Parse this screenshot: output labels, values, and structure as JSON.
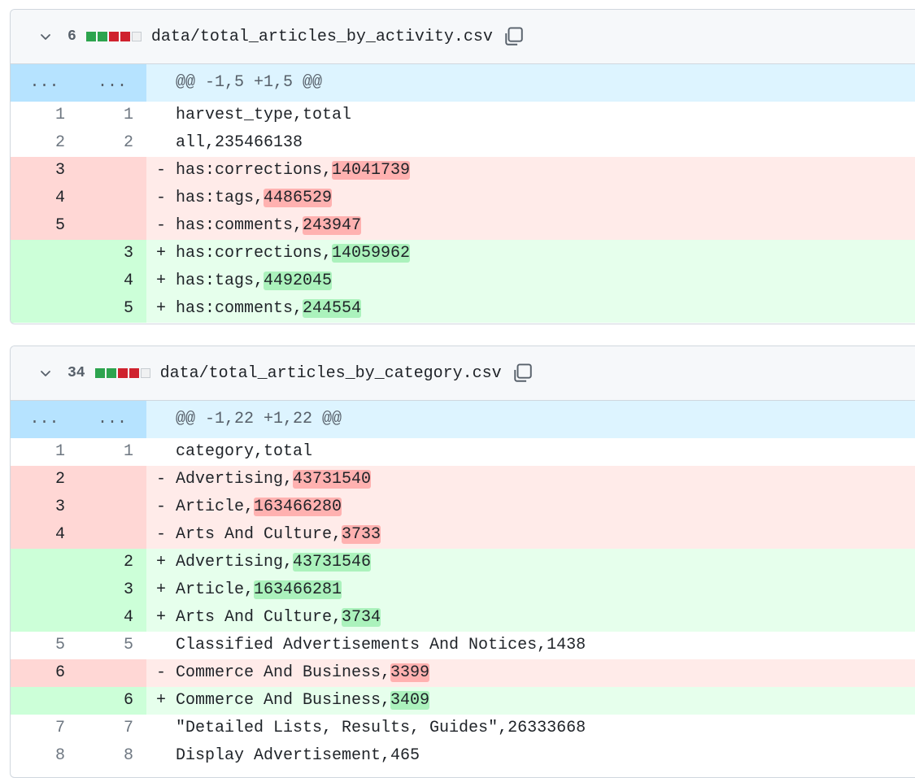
{
  "files": [
    {
      "count": "6",
      "blocks": [
        "add",
        "add",
        "del",
        "del",
        "neutral"
      ],
      "name": "data/total_articles_by_activity.csv",
      "hunk": "@@ -1,5 +1,5 @@",
      "hunk_dots_left": "...",
      "hunk_dots_right": "...",
      "rows": [
        {
          "type": "ctx",
          "old": "1",
          "new": "1",
          "mark": "",
          "text": "harvest_type,total",
          "hl": ""
        },
        {
          "type": "ctx",
          "old": "2",
          "new": "2",
          "mark": "",
          "text": "all,235466138",
          "hl": ""
        },
        {
          "type": "del",
          "old": "3",
          "new": "",
          "mark": "-",
          "text": "has:corrections,",
          "hl": "14041739"
        },
        {
          "type": "del",
          "old": "4",
          "new": "",
          "mark": "-",
          "text": "has:tags,",
          "hl": "4486529"
        },
        {
          "type": "del",
          "old": "5",
          "new": "",
          "mark": "-",
          "text": "has:comments,",
          "hl": "243947"
        },
        {
          "type": "add",
          "old": "",
          "new": "3",
          "mark": "+",
          "text": "has:corrections,",
          "hl": "14059962"
        },
        {
          "type": "add",
          "old": "",
          "new": "4",
          "mark": "+",
          "text": "has:tags,",
          "hl": "4492045"
        },
        {
          "type": "add",
          "old": "",
          "new": "5",
          "mark": "+",
          "text": "has:comments,",
          "hl": "244554"
        }
      ]
    },
    {
      "count": "34",
      "blocks": [
        "add",
        "add",
        "del",
        "del",
        "neutral"
      ],
      "name": "data/total_articles_by_category.csv",
      "hunk": "@@ -1,22 +1,22 @@",
      "hunk_dots_left": "...",
      "hunk_dots_right": "...",
      "rows": [
        {
          "type": "ctx",
          "old": "1",
          "new": "1",
          "mark": "",
          "text": "category,total",
          "hl": ""
        },
        {
          "type": "del",
          "old": "2",
          "new": "",
          "mark": "-",
          "text": "Advertising,",
          "hl": "43731540"
        },
        {
          "type": "del",
          "old": "3",
          "new": "",
          "mark": "-",
          "text": "Article,",
          "hl": "163466280"
        },
        {
          "type": "del",
          "old": "4",
          "new": "",
          "mark": "-",
          "text": "Arts And Culture,",
          "hl": "3733"
        },
        {
          "type": "add",
          "old": "",
          "new": "2",
          "mark": "+",
          "text": "Advertising,",
          "hl": "43731546"
        },
        {
          "type": "add",
          "old": "",
          "new": "3",
          "mark": "+",
          "text": "Article,",
          "hl": "163466281"
        },
        {
          "type": "add",
          "old": "",
          "new": "4",
          "mark": "+",
          "text": "Arts And Culture,",
          "hl": "3734"
        },
        {
          "type": "ctx",
          "old": "5",
          "new": "5",
          "mark": "",
          "text": "Classified Advertisements And Notices,1438",
          "hl": ""
        },
        {
          "type": "del",
          "old": "6",
          "new": "",
          "mark": "-",
          "text": "Commerce And Business,",
          "hl": "3399"
        },
        {
          "type": "add",
          "old": "",
          "new": "6",
          "mark": "+",
          "text": "Commerce And Business,",
          "hl": "3409"
        },
        {
          "type": "ctx",
          "old": "7",
          "new": "7",
          "mark": "",
          "text": "\"Detailed Lists, Results, Guides\",26333668",
          "hl": ""
        },
        {
          "type": "ctx",
          "old": "8",
          "new": "8",
          "mark": "",
          "text": "Display Advertisement,465",
          "hl": ""
        }
      ]
    }
  ],
  "icons": {
    "collapse": "chevron-down-icon",
    "copy": "copy-icon"
  },
  "colors": {
    "add_block": "#2da44e",
    "del_block": "#cf222e",
    "del_bg": "#ffebe9",
    "add_bg": "#e6ffec",
    "hunk_bg": "#ddf4ff"
  }
}
